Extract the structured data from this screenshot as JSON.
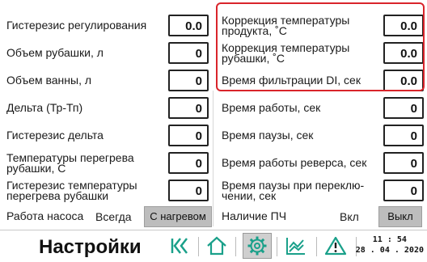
{
  "left_params": [
    {
      "label": "Гистерезис регулирования",
      "value": "0.0"
    },
    {
      "label": "Объем рубашки, л",
      "value": "0"
    },
    {
      "label": "Объем ванны, л",
      "value": "0"
    },
    {
      "label": "Дельта (Тр-Тп)",
      "value": "0"
    },
    {
      "label": "Гистерезис дельта",
      "value": "0"
    },
    {
      "label": "Температуры перегрева\nрубашки, С",
      "value": "0"
    },
    {
      "label": "Гистерезис температуры\nперегрева рубашки",
      "value": "0"
    }
  ],
  "right_params": [
    {
      "label": "Коррекция температуры\nпродукта, ˚С",
      "value": "0.0"
    },
    {
      "label": "Коррекция температуры\nрубашки, ˚С",
      "value": "0.0"
    },
    {
      "label": "Время фильтрации DI, сек",
      "value": "0.0"
    },
    {
      "label": "Время работы, сек",
      "value": "0"
    },
    {
      "label": "Время паузы, сек",
      "value": "0"
    },
    {
      "label": "Время работы реверса, сек",
      "value": "0"
    },
    {
      "label": "Время паузы при переклю-\nчении, сек",
      "value": "0"
    }
  ],
  "pump": {
    "label": "Работа насоса",
    "mode": "Всегда",
    "button": "С нагревом"
  },
  "pch": {
    "label": "Наличие ПЧ",
    "value": "Вкл",
    "button": "Выкл"
  },
  "footer": {
    "title": "Настройки",
    "time": "11 : 54",
    "date": "28 . 04 . 2020"
  },
  "nav_icons": [
    "first-page-icon",
    "home-icon",
    "settings-gear-icon",
    "chart-icon",
    "alarm-warning-icon"
  ],
  "colors": {
    "highlight": "#d9242b",
    "toggle_bg": "#bdbdbd",
    "nav_icon": "#1aa08a"
  }
}
